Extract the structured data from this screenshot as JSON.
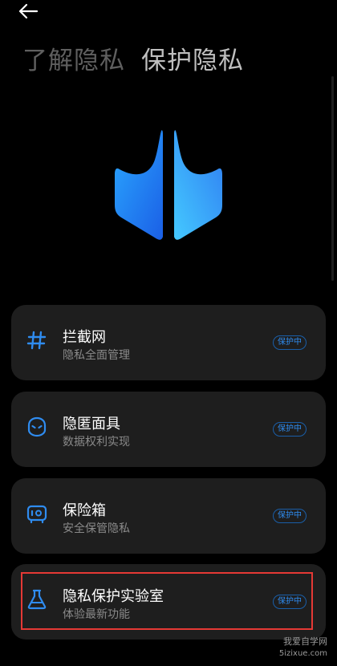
{
  "header": {
    "back_icon": "back-arrow-icon",
    "tabs": [
      {
        "label": "了解隐私",
        "active": false
      },
      {
        "label": "保护隐私",
        "active": true
      }
    ]
  },
  "hero": {
    "icon": "privacy-shield-logo",
    "colors": [
      "#2fa3ff",
      "#1f6bf0",
      "#42c7ff"
    ]
  },
  "cards": [
    {
      "icon": "hash-icon",
      "title": "拦截网",
      "subtitle": "隐私全面管理",
      "status": "保护中"
    },
    {
      "icon": "mask-icon",
      "title": "隐匿面具",
      "subtitle": "数据权利实现",
      "status": "保护中"
    },
    {
      "icon": "safe-icon",
      "title": "保险箱",
      "subtitle": "安全保管隐私",
      "status": "保护中"
    },
    {
      "icon": "flask-icon",
      "title": "隐私保护实验室",
      "subtitle": "体验最新功能",
      "status": "保护中"
    }
  ],
  "watermark": {
    "line1": "我爱自学网",
    "line2": "5izixue.com"
  },
  "colors": {
    "accent": "#2f8cf0",
    "card_bg": "#1e1e1e",
    "highlight": "#e53935"
  }
}
